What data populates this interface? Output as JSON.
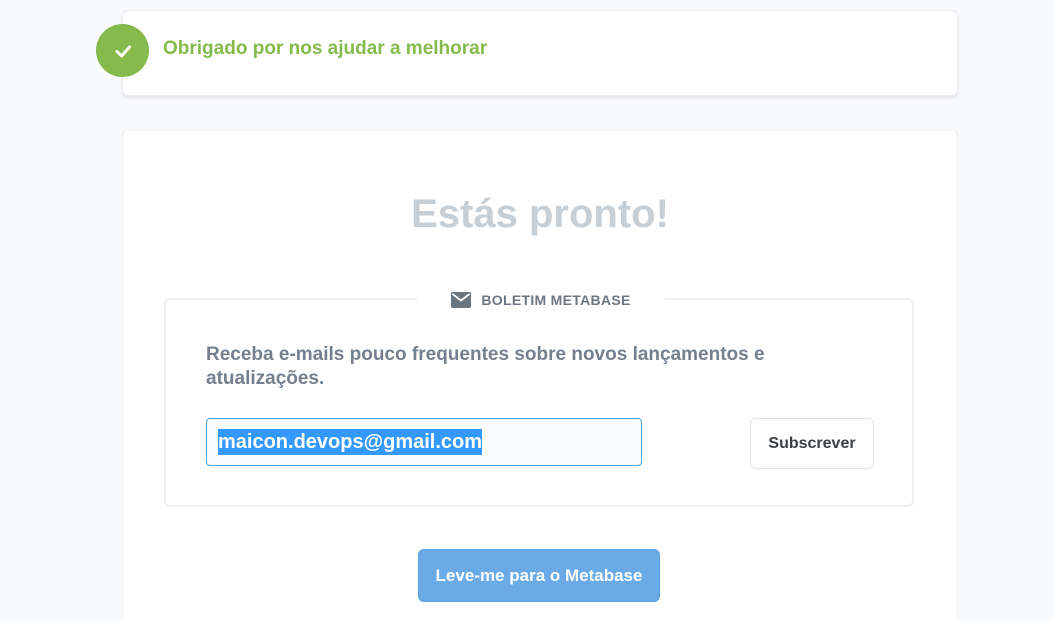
{
  "notice": {
    "icon": "check-icon",
    "text": "Obrigado por nos ajudar a melhorar",
    "color": "#84bb4c"
  },
  "main": {
    "title": "Estás pronto!",
    "newsletter": {
      "icon": "mail-icon",
      "legend": "BOLETIM METABASE",
      "description": "Receba e-mails pouco frequentes sobre novos lançamentos e atualizações.",
      "email_value": "maicon.devops@gmail.com",
      "subscribe_label": "Subscrever"
    },
    "cta_label": "Leve-me para o Metabase"
  },
  "colors": {
    "brand": "#509ee3",
    "success": "#84bb4c",
    "title": "#c6ced6"
  }
}
